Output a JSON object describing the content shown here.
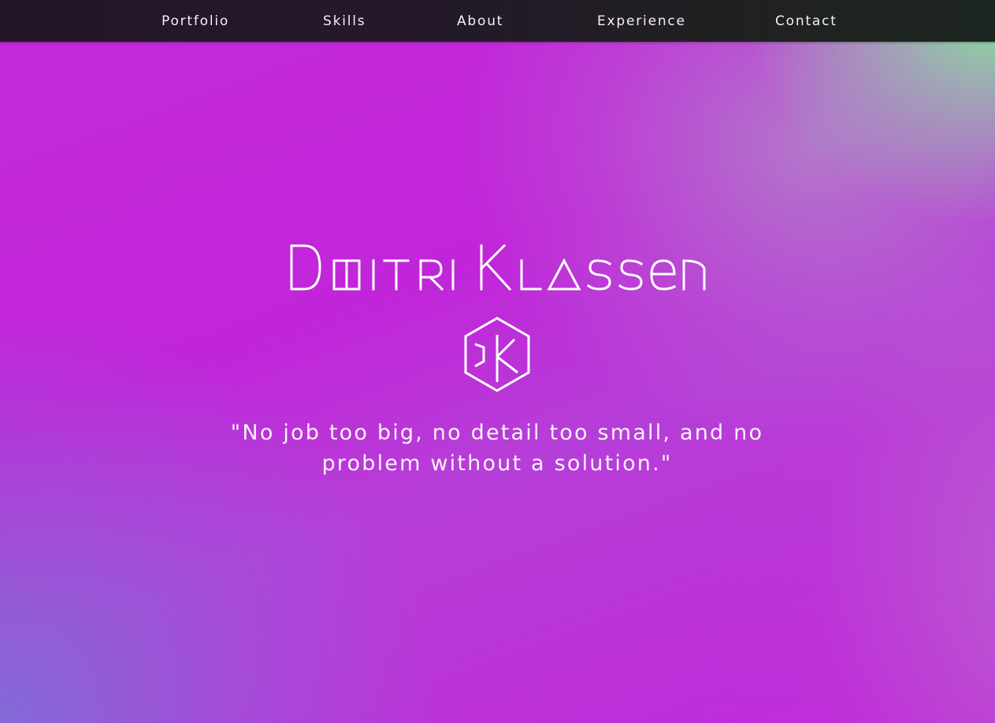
{
  "nav": {
    "items": [
      {
        "label": "Portfolio"
      },
      {
        "label": "Skills"
      },
      {
        "label": "About"
      },
      {
        "label": "Experience"
      },
      {
        "label": "Contact"
      }
    ]
  },
  "hero": {
    "name": "Dmitri Klassen",
    "logo_icon": "dk-hexagon-monogram-icon",
    "quote": "\"No job too big, no detail too small, and no problem without a solution.\""
  },
  "colors": {
    "nav_background": "#241629",
    "background_primary": "#c125d9",
    "background_accent_green": "#82eb96",
    "background_accent_blue_violet": "#806cd7",
    "text": "#ffffff"
  }
}
